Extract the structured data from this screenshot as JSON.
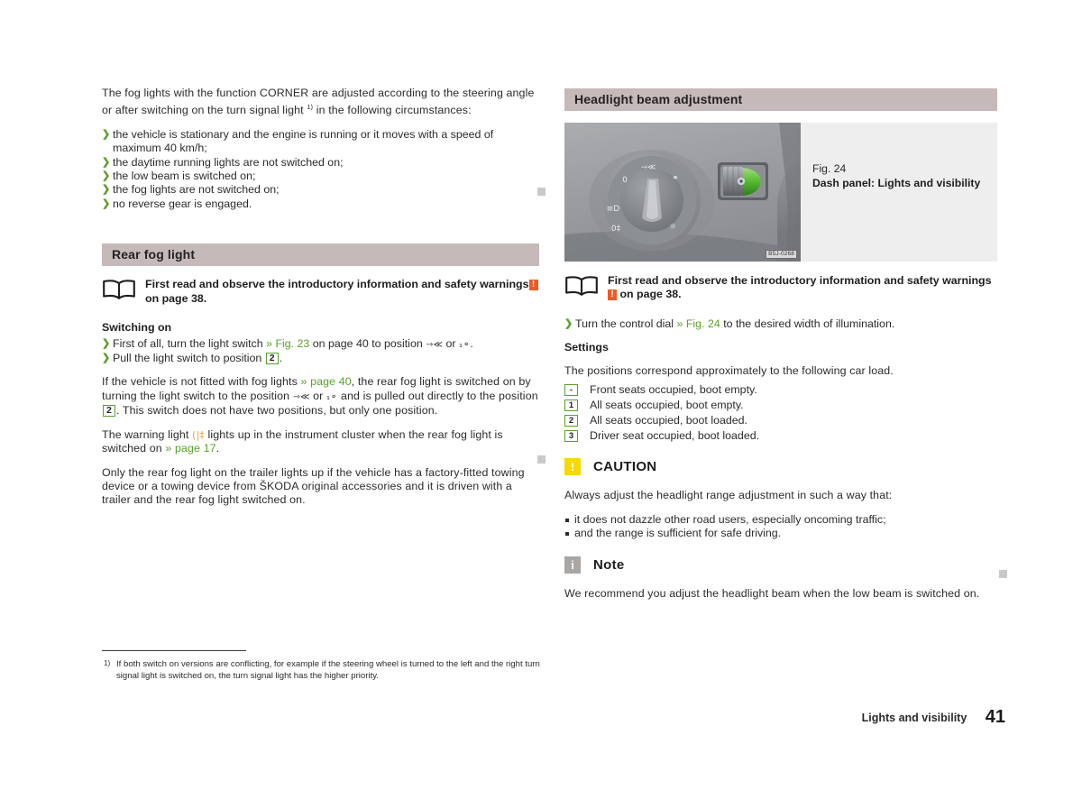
{
  "page": {
    "footer_section": "Lights and visibility",
    "number": "41"
  },
  "left_column": {
    "intro_paragraph": "The fog lights with the function CORNER are adjusted according to the steering angle or after switching on the turn signal light",
    "intro_footnote_mark": "1)",
    "intro_paragraph_tail": "in the following circumstances:",
    "conditions": [
      "the vehicle is stationary and the engine is running or it moves with a speed of maximum 40 km/h;",
      "the daytime running lights are not switched on;",
      "the low beam is switched on;",
      "the fog lights are not switched on;",
      "no reverse gear is engaged."
    ],
    "section": {
      "title": "Rear fog light",
      "read_first": {
        "text_before": "First read and observe the introductory information and safety warnings",
        "chip": "!",
        "text_after": "on page 38."
      },
      "switching_on_heading": "Switching on",
      "steps": [
        {
          "before": "First of all, turn the light switch",
          "xref": "» Fig. 23",
          "middle": "on page 40 to position",
          "symbol_a": "low-beam-symbol",
          "conj": "or",
          "symbol_b": "parking-light-symbol",
          "after": "."
        },
        {
          "before": "Pull the light switch to position",
          "box": "2",
          "after": "."
        }
      ],
      "paragraph_no_fog": {
        "part1": "If the vehicle is not fitted with fog lights",
        "xref": "» page 40",
        "part2": ", the rear fog light is switched on by turning the light switch to the position",
        "symbol_a": "low-beam-symbol",
        "conj": "or",
        "symbol_b": "parking-light-symbol",
        "part3": "and is pulled out directly to the position",
        "box": "2",
        "part4": ". This switch does not have two positions, but only one position."
      },
      "paragraph_warning_light": {
        "part1": "The warning light",
        "symbol": "rear-fog-light-symbol",
        "part2": "lights up in the instrument cluster when the rear fog light is switched on",
        "xref": "» page 17",
        "part3": "."
      },
      "paragraph_trailer": "Only the rear fog light on the trailer lights up if the vehicle has a factory-fitted towing device or a towing device from ŠKODA original accessories and it is driven with a trailer and the rear fog light switched on."
    },
    "footnote": {
      "mark": "1)",
      "text": "If both switch on versions are conflicting, for example if the steering wheel is turned to the left and the right turn signal light is switched on, the turn signal light has the higher priority."
    }
  },
  "right_column": {
    "section_title": "Headlight beam adjustment",
    "figure": {
      "caption_line1": "Fig. 24",
      "caption_line2": "Dash panel: Lights and visibility",
      "image_id": "B5J-0268",
      "alt": "Dash panel light switch dial and green headlight range adjustment control"
    },
    "read_first": {
      "text_before": "First read and observe the introductory information and safety warnings",
      "chip": "!",
      "text_after": "on page 38."
    },
    "step": {
      "before": "Turn the control dial",
      "xref": "» Fig. 24",
      "after": "to the desired width of illumination."
    },
    "settings_heading": "Settings",
    "settings_intro": "The positions correspond approximately to the following car load.",
    "settings_rows": [
      {
        "key": "-",
        "label": "Front seats occupied, boot empty."
      },
      {
        "key": "1",
        "label": "All seats occupied, boot empty."
      },
      {
        "key": "2",
        "label": "All seats occupied, boot loaded."
      },
      {
        "key": "3",
        "label": "Driver seat occupied, boot loaded."
      }
    ],
    "caution": {
      "icon": "!",
      "title": "CAUTION",
      "intro": "Always adjust the headlight range adjustment in such a way that:",
      "items": [
        "it does not dazzle other road users, especially oncoming traffic;",
        "and the range is sufficient for safe driving."
      ]
    },
    "note": {
      "icon": "i",
      "title": "Note",
      "text": "We recommend you adjust the headlight beam when the low beam is switched on."
    }
  },
  "colors": {
    "section_header_bg": "#c6b9b9",
    "link_green": "#5aa02c",
    "warn_orange": "#ef5a24",
    "caution_yellow": "#f7d900",
    "note_grey": "#a9a6a3",
    "marker_grey": "#c9c9c9"
  }
}
